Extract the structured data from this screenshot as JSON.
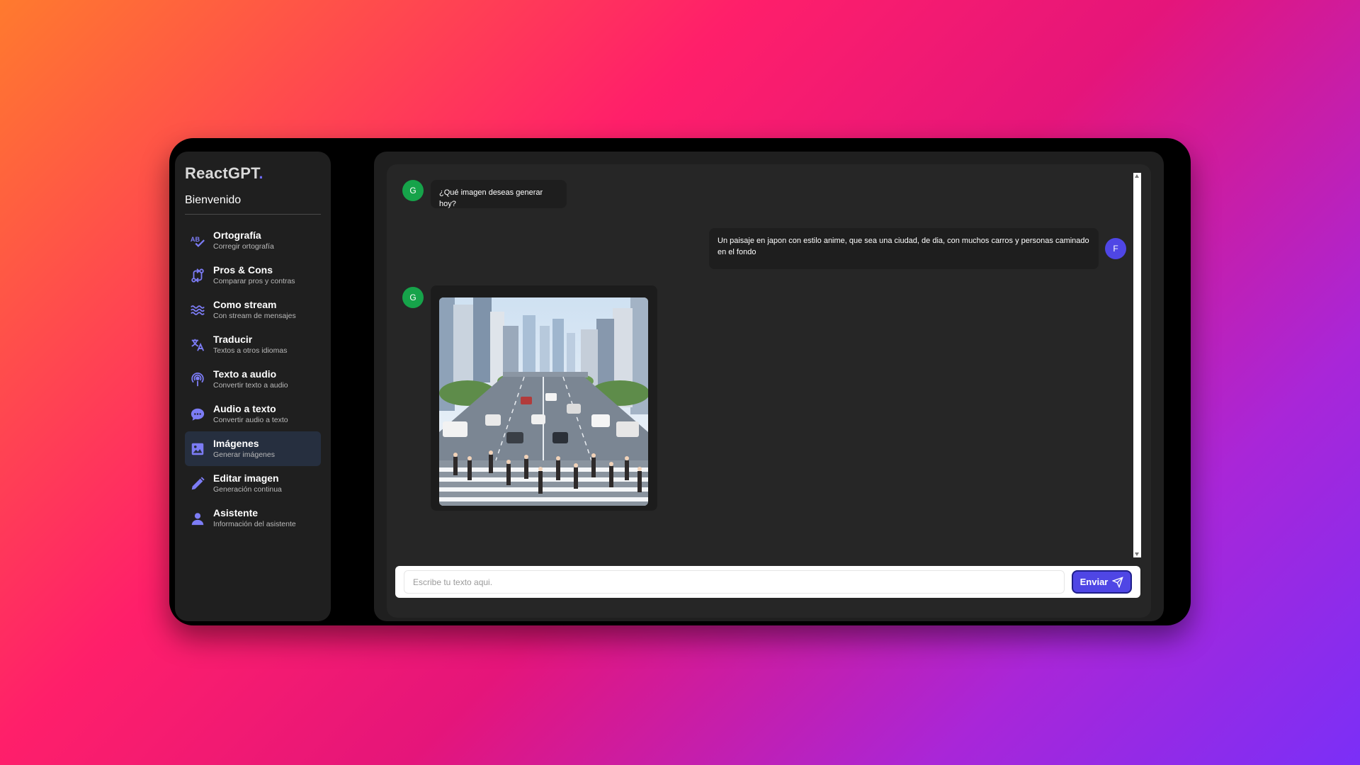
{
  "app": {
    "title": "ReactGPT",
    "title_dot": "."
  },
  "sidebar": {
    "welcome": "Bienvenido",
    "items": [
      {
        "title": "Ortografía",
        "subtitle": "Corregir ortografía",
        "icon": "spellcheck-icon",
        "active": false
      },
      {
        "title": "Pros & Cons",
        "subtitle": "Comparar pros y contras",
        "icon": "compare-arrows-icon",
        "active": false
      },
      {
        "title": "Como stream",
        "subtitle": "Con stream de mensajes",
        "icon": "waves-icon",
        "active": false
      },
      {
        "title": "Traducir",
        "subtitle": "Textos a otros idiomas",
        "icon": "translate-icon",
        "active": false
      },
      {
        "title": "Texto a audio",
        "subtitle": "Convertir texto a audio",
        "icon": "podcast-icon",
        "active": false
      },
      {
        "title": "Audio a texto",
        "subtitle": "Convertir audio a texto",
        "icon": "chat-bubble-icon",
        "active": false
      },
      {
        "title": "Imágenes",
        "subtitle": "Generar imágenes",
        "icon": "image-icon",
        "active": true
      },
      {
        "title": "Editar imagen",
        "subtitle": "Generación continua",
        "icon": "pencil-icon",
        "active": false
      },
      {
        "title": "Asistente",
        "subtitle": "Información del asistente",
        "icon": "user-icon",
        "active": false
      }
    ]
  },
  "chat": {
    "messages": [
      {
        "sender": "G",
        "text": "¿Qué imagen deseas generar hoy?"
      },
      {
        "sender": "F",
        "text": "Un paisaje en japon con estilo anime, que sea una ciudad, de dia, con muchos carros y personas caminado en el fondo"
      },
      {
        "sender": "G",
        "type": "image"
      }
    ]
  },
  "input": {
    "placeholder": "Escribe tu texto aqui.",
    "value": "",
    "send_label": "Enviar"
  },
  "colors": {
    "accent": "#4f46e5",
    "bot_avatar": "#16a34a",
    "user_avatar": "#4f46e5",
    "icon": "#7c7cf5"
  }
}
